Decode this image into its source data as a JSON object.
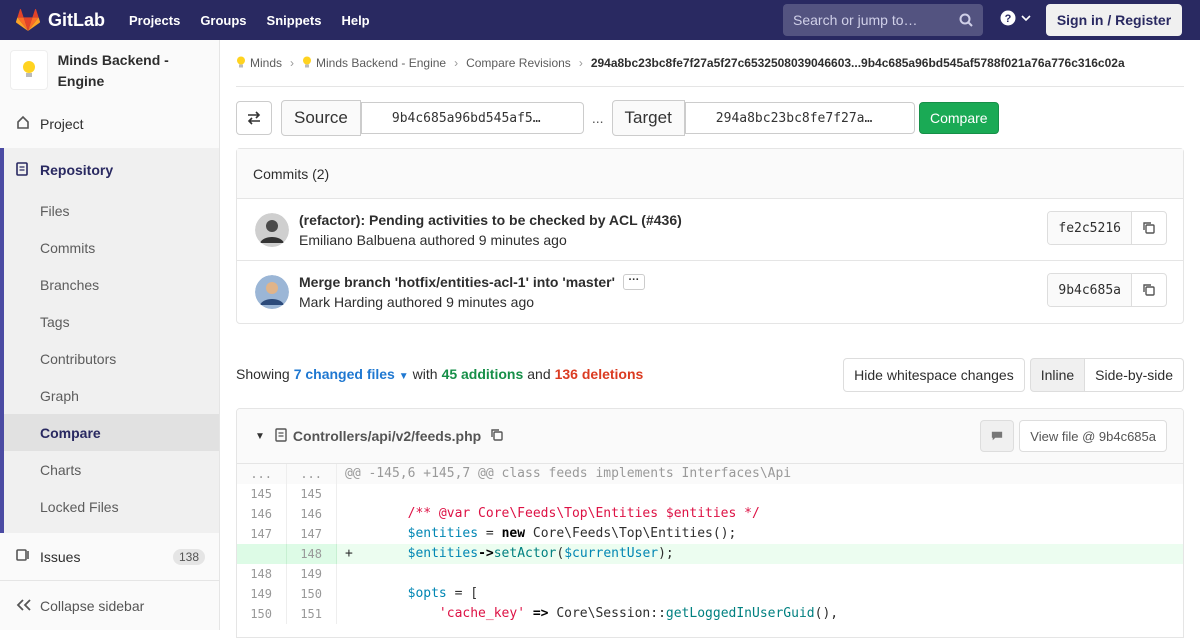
{
  "topbar": {
    "brand": "GitLab",
    "nav": [
      "Projects",
      "Groups",
      "Snippets",
      "Help"
    ],
    "search_placeholder": "Search or jump to…",
    "signin": "Sign in / Register"
  },
  "sidebar": {
    "project_name": "Minds Backend - Engine",
    "project": "Project",
    "repository": "Repository",
    "repo_items": [
      "Files",
      "Commits",
      "Branches",
      "Tags",
      "Contributors",
      "Graph",
      "Compare",
      "Charts",
      "Locked Files"
    ],
    "active": "Compare",
    "issues": "Issues",
    "issues_count": "138",
    "collapse": "Collapse sidebar"
  },
  "breadcrumbs": [
    "Minds",
    "Minds Backend - Engine",
    "Compare Revisions",
    "294a8bc23bc8fe7f27a5f27c6532508039046603...9b4c685a96bd545af5788f021a76a776c316c02a"
  ],
  "compare": {
    "source_label": "Source",
    "source_value": "9b4c685a96bd545af5…",
    "dots": "...",
    "target_label": "Target",
    "target_value": "294a8bc23bc8fe7f27a…",
    "button": "Compare"
  },
  "commits": {
    "header": "Commits (2)",
    "items": [
      {
        "title": "(refactor): Pending activities to be checked by ACL (#436)",
        "meta": "Emiliano Balbuena authored 9 minutes ago",
        "sha": "fe2c5216"
      },
      {
        "title": "Merge branch 'hotfix/entities-acl-1' into 'master'",
        "meta": "Mark Harding authored 9 minutes ago",
        "sha": "9b4c685a"
      }
    ]
  },
  "stats": {
    "showing": "Showing",
    "changed": "7 changed files",
    "with": "with",
    "additions": "45 additions",
    "and": "and",
    "deletions": "136 deletions",
    "hide_ws": "Hide whitespace changes",
    "inline": "Inline",
    "side": "Side-by-side"
  },
  "file": {
    "path": "Controllers/api/v2/feeds.php",
    "view": "View file @ 9b4c685a"
  },
  "diff": [
    {
      "o": "...",
      "n": "...",
      "t": "match",
      "c": "@@ -145,6 +145,7 @@ class feeds implements Interfaces\\Api"
    },
    {
      "o": "145",
      "n": "145",
      "t": "ctx",
      "c": ""
    },
    {
      "o": "146",
      "n": "146",
      "t": "ctx",
      "c": "        /** @var Core\\Feeds\\Top\\Entities $entities */"
    },
    {
      "o": "147",
      "n": "147",
      "t": "ctx",
      "c": "        $entities = new Core\\Feeds\\Top\\Entities();"
    },
    {
      "o": "",
      "n": "148",
      "t": "add",
      "c": "+       $entities->setActor($currentUser);"
    },
    {
      "o": "148",
      "n": "149",
      "t": "ctx",
      "c": ""
    },
    {
      "o": "149",
      "n": "150",
      "t": "ctx",
      "c": "        $opts = ["
    },
    {
      "o": "150",
      "n": "151",
      "t": "ctx",
      "c": "            'cache_key' => Core\\Session::getLoggedInUserGuid(),"
    }
  ]
}
